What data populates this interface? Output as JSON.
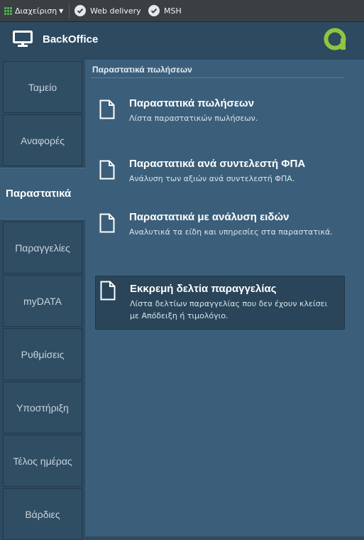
{
  "toolbar": {
    "management_label": "Διαχείριση",
    "web_delivery_label": "Web delivery",
    "msh_label": "MSH"
  },
  "header": {
    "app_title": "BackOffice"
  },
  "sidebar": {
    "items": [
      {
        "label": "Ταμείο"
      },
      {
        "label": "Αναφορές"
      },
      {
        "label": "Παραστατικά"
      },
      {
        "label": "Παραγγελίες"
      },
      {
        "label": "myDATA"
      },
      {
        "label": "Ρυθμίσεις"
      },
      {
        "label": "Υποστήριξη"
      },
      {
        "label": "Τέλος ημέρας"
      },
      {
        "label": "Βάρδιες"
      }
    ],
    "active_index": 2
  },
  "main": {
    "section_title": "Παραστατικά πωλήσεων",
    "documents": [
      {
        "title": "Παραστατικά πωλήσεων",
        "description": "Λίστα παραστατικών πωλήσεων."
      },
      {
        "title": "Παραστατικά ανά συντελεστή ΦΠΑ",
        "description": "Ανάλυση των αξιών ανά συντελεστή ΦΠΑ."
      },
      {
        "title": "Παραστατικά με ανάλυση ειδών",
        "description": "Αναλυτικά τα είδη και υπηρεσίες στα παραστατικά."
      },
      {
        "title": "Εκκρεμή δελτία παραγγελίας",
        "description": "Λίστα δελτίων παραγγελίας που δεν έχουν κλείσει με Απόδειξη ή τιμολόγιο."
      }
    ]
  },
  "colors": {
    "background": "#2d4a60",
    "content_panel": "#3b5f7a",
    "highlight_card": "#2a4559",
    "logo_green": "#8dc63f",
    "toolbar": "#3a3f44"
  },
  "icons": {
    "toolbar_menu": "grid-icon",
    "toolbar_check": "check-circle-icon",
    "header": "monitor-icon",
    "logo": "brand-logo-icon",
    "document": "document-icon"
  }
}
